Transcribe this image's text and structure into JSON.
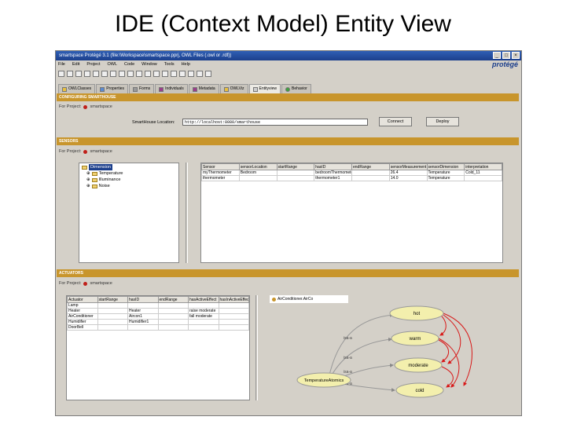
{
  "slide": {
    "title": "IDE (Context Model) Entity View"
  },
  "window": {
    "title": "smartspace Protégé 3.1 (file:\\Workspace\\smartspace.pprj, OWL Files (.owl or .rdf))",
    "menu": [
      "File",
      "Edit",
      "Project",
      "OWL",
      "Code",
      "Window",
      "Tools",
      "Help"
    ],
    "logo": "protégé",
    "tabs": [
      {
        "label": "OWLClasses"
      },
      {
        "label": "Properties"
      },
      {
        "label": "Forms"
      },
      {
        "label": "Individuals"
      },
      {
        "label": "Metadata"
      },
      {
        "label": "OWLViz"
      },
      {
        "label": "Entityview",
        "active": true
      },
      {
        "label": "Behavior"
      }
    ]
  },
  "config": {
    "header": "CONFIGURING SMARTHOUSE",
    "project_label": "For Project:",
    "project_name": "smartspace",
    "location_label": "SmartHouse Location:",
    "location_value": "http://localhost:8080/smarthouse",
    "connect_label": "Connect",
    "deploy_label": "Deploy"
  },
  "sensors": {
    "header": "SENSORS",
    "project_label": "For Project:",
    "project_name": "smartspace",
    "tree": [
      {
        "label": "Dimension",
        "level": 0,
        "selected": true
      },
      {
        "label": "Temperature",
        "level": 1
      },
      {
        "label": "Illuminance",
        "level": 1
      },
      {
        "label": "Noise",
        "level": 1
      }
    ],
    "columns": [
      "Sensor",
      "sensorLocation",
      "startRange",
      "hasID",
      "endRange",
      "sensorMeasurement",
      "sensorDimension",
      "interpretation"
    ],
    "rows": [
      [
        "myThermometer",
        "Bedroom",
        "",
        "bedroomThermometer1",
        "",
        "26.4",
        "Temperature",
        "Cold_11"
      ],
      [
        "thermometer",
        "",
        "",
        "thermometer1",
        "",
        "14.0",
        "Temperature",
        ""
      ]
    ]
  },
  "actuators": {
    "header": "ACTUATORS",
    "project_label": "For Project:",
    "project_name": "smartspace",
    "columns": [
      "Actuator",
      "startRange",
      "hasID",
      "endRange",
      "hasActiveEffect",
      "hasInActiveEffect"
    ],
    "rows": [
      [
        "Lamp",
        "",
        "",
        "",
        "",
        ""
      ],
      [
        "Heater",
        "",
        "Heater",
        "",
        "raise moderate",
        ""
      ],
      [
        "AirConditioner",
        "",
        "Aircon1",
        "",
        "fall moderate",
        ""
      ],
      [
        "Humidifier",
        "",
        "Humidifier1",
        "",
        "",
        ""
      ],
      [
        "DoorBell",
        "",
        "",
        "",
        "",
        ""
      ]
    ],
    "graph_title": "AirConditioner.AirCo",
    "graph": {
      "source": "TemperatureAtomics",
      "targets": [
        "hot",
        "warm",
        "moderate",
        "cold"
      ],
      "edge_labels": [
        "isa-a",
        "isa-a",
        "isa-a",
        "isa-a"
      ]
    }
  },
  "colors": {
    "panel_header": "#c8952c",
    "node_fill": "#f3efad",
    "edge_red": "#d81818"
  }
}
